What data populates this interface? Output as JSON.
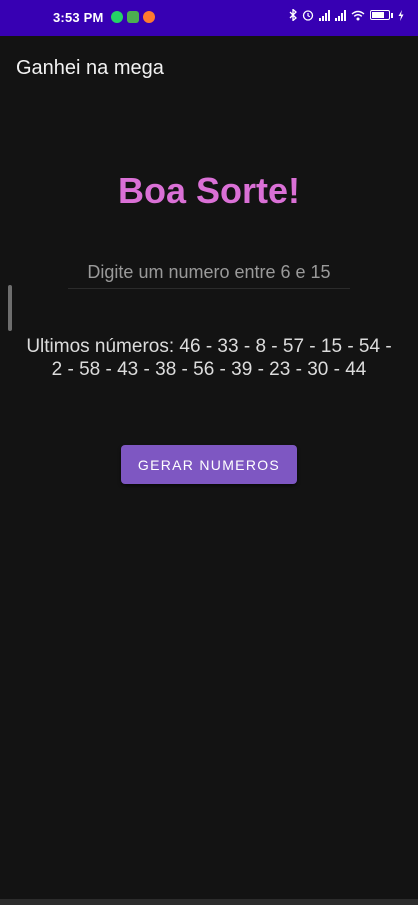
{
  "status_bar": {
    "time": "3:53 PM",
    "battery_level": "67",
    "background_color": "#3700b3"
  },
  "app_bar": {
    "title": "Ganhei na mega"
  },
  "main": {
    "headline": "Boa Sorte!",
    "headline_color": "#da70d6",
    "input_placeholder": "Digite um numero entre 6 e 15",
    "input_value": "",
    "results_text": "Ultimos números: 46 - 33 - 8 - 57 - 15 - 54 - 2 - 58 - 43 - 38 - 56 - 39 - 23 - 30 - 44",
    "button_label": "GERAR NUMEROS",
    "button_color": "#7e57c2"
  },
  "icons": {
    "notifications": [
      "whatsapp-icon",
      "app-notification-icon",
      "orange-app-icon"
    ],
    "status": [
      "bluetooth-icon",
      "alarm-icon",
      "signal-icon",
      "signal-icon",
      "wifi-icon",
      "battery-icon",
      "charging-icon"
    ]
  }
}
